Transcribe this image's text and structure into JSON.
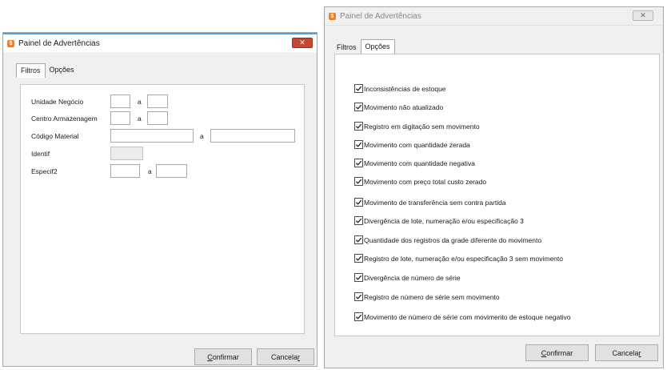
{
  "colors": {
    "titlebar_left": "#ffffff",
    "title_divider": "#4aa3df",
    "close_red": "#c9452f",
    "window_bg": "#f0f0f0"
  },
  "left": {
    "title": "Painel de Advertências",
    "tabs": [
      "Filtros",
      "Opções"
    ],
    "fields": {
      "unidade": "Unidade Negócio",
      "centro": "Centro Armazenagem",
      "codigo": "Código Material",
      "identif": "Identif",
      "especif": "Especif2",
      "sep": "a"
    },
    "buttons": {
      "confirmar_u": "C",
      "confirmar_rest": "onfirmar",
      "cancelar_pre": "Cancela",
      "cancelar_u": "r"
    }
  },
  "right": {
    "title": "Painel de Advertências",
    "tabs": [
      "Filtros",
      "Opções"
    ],
    "options": [
      "Inconsistências de estoque",
      "Movimento não atualizado",
      "Registro em digitação sem movimento",
      "Movimento com quantidade zerada",
      "Movimento com quantidade negativa",
      "Movimento com preço total custo zerado",
      "Movimento de transferência sem contra partida",
      "Divergência de lote, numeração e/ou especificação 3",
      "Quantidade dos registros da grade diferente do movimento",
      "Registro de lote, numeração e/ou especificação 3 sem movimento",
      "Divergência de número de série",
      "Registro de número de série sem movimento",
      "Movimento de número de série com movimento de estoque negativo"
    ],
    "buttons": {
      "confirmar_u": "C",
      "confirmar_rest": "onfirmar",
      "cancelar_pre": "Cancela",
      "cancelar_u": "r"
    }
  }
}
